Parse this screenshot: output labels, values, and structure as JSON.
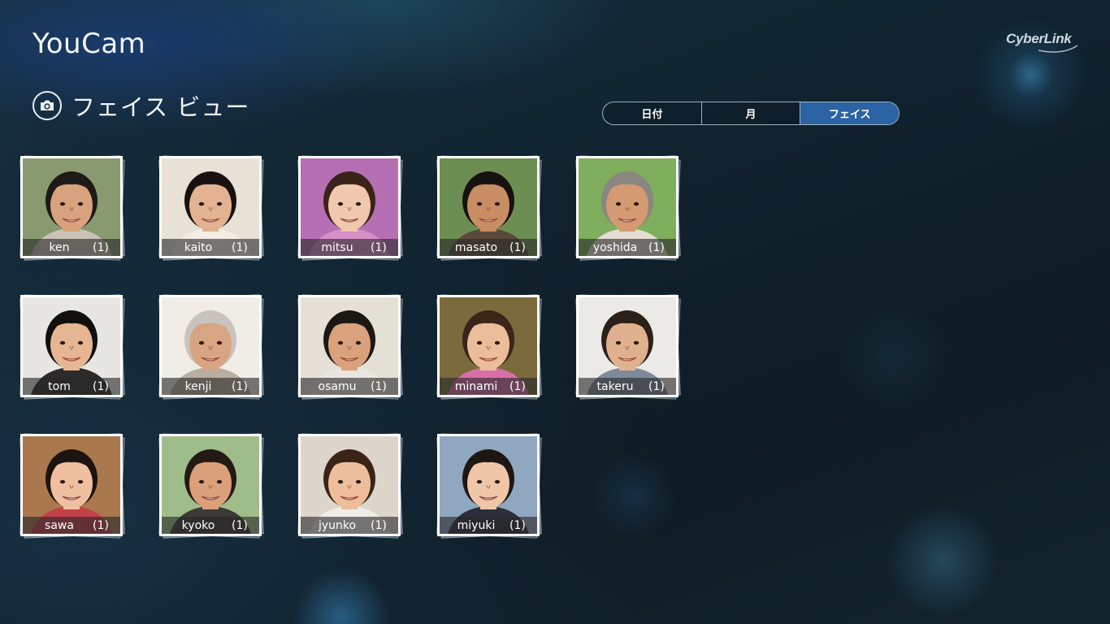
{
  "app": {
    "title": "YouCam",
    "brand": "CyberLink"
  },
  "section": {
    "title": "フェイス ビュー",
    "icon": "camera-icon"
  },
  "view_tabs": [
    {
      "label": "日付",
      "active": false
    },
    {
      "label": "月",
      "active": false
    },
    {
      "label": "フェイス",
      "active": true
    }
  ],
  "colors": {
    "active_tab": "#2c63a4",
    "background": "#10222e",
    "frame": "#ffffff"
  },
  "faces": [
    {
      "name": "ken",
      "count": "(1)",
      "bg": "#8a9a70",
      "skin": "#d8a27e",
      "hair": "#1e1a18",
      "shirt": "#c9c3b5"
    },
    {
      "name": "kaito",
      "count": "(1)",
      "bg": "#e8e2d6",
      "skin": "#e3b290",
      "hair": "#17120f",
      "shirt": "#f2eee6"
    },
    {
      "name": "mitsu",
      "count": "(1)",
      "bg": "#b56fb2",
      "skin": "#f0c8ae",
      "hair": "#3a2318",
      "shirt": "#d88fc8"
    },
    {
      "name": "masato",
      "count": "(1)",
      "bg": "#6d8e52",
      "skin": "#c98d64",
      "hair": "#161210",
      "shirt": "#5b4a3c"
    },
    {
      "name": "yoshida",
      "count": "(1)",
      "bg": "#7fae5c",
      "skin": "#d49a72",
      "hair": "#8a8682",
      "shirt": "#e4ddd2"
    },
    {
      "name": "tom",
      "count": "(1)",
      "bg": "#e8e6e3",
      "skin": "#e6b692",
      "hair": "#120f0d",
      "shirt": "#2c2a2a"
    },
    {
      "name": "kenji",
      "count": "(1)",
      "bg": "#f0ede6",
      "skin": "#d7a583",
      "hair": "#c8c4bd",
      "shirt": "#b7ae9f"
    },
    {
      "name": "osamu",
      "count": "(1)",
      "bg": "#e5e0d6",
      "skin": "#d9a27c",
      "hair": "#1d1714",
      "shirt": "#e9e6e0"
    },
    {
      "name": "minami",
      "count": "(1)",
      "bg": "#7a6a3c",
      "skin": "#ebbd9a",
      "hair": "#3b2518",
      "shirt": "#d86fa6"
    },
    {
      "name": "takeru",
      "count": "(1)",
      "bg": "#eceae6",
      "skin": "#e0b18e",
      "hair": "#2a2119",
      "shirt": "#7d8b99"
    },
    {
      "name": "sawa",
      "count": "(1)",
      "bg": "#a9784c",
      "skin": "#eec0a0",
      "hair": "#1c1410",
      "shirt": "#c33f4a"
    },
    {
      "name": "kyoko",
      "count": "(1)",
      "bg": "#9fbd8a",
      "skin": "#d9a07a",
      "hair": "#241a14",
      "shirt": "#3c3936"
    },
    {
      "name": "jyunko",
      "count": "(1)",
      "bg": "#dcd6cc",
      "skin": "#eebd9c",
      "hair": "#3a2418",
      "shirt": "#f0ece6"
    },
    {
      "name": "miyuki",
      "count": "(1)",
      "bg": "#8fa7bf",
      "skin": "#efc6a8",
      "hair": "#1e1613",
      "shirt": "#2b2f3a"
    }
  ]
}
